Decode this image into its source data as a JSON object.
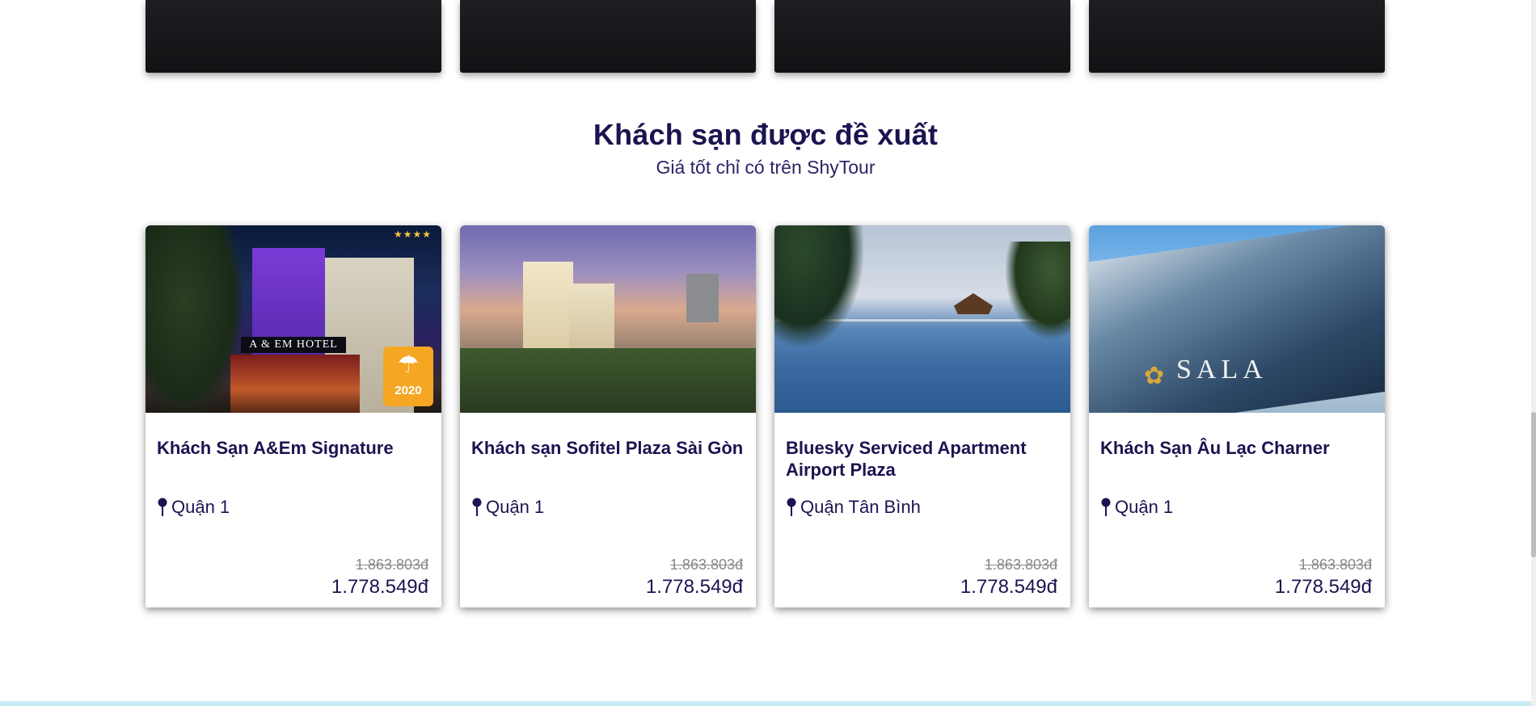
{
  "section": {
    "title": "Khách sạn được đề xuất",
    "subtitle": "Giá tốt chỉ có trên ShyTour"
  },
  "hotels": [
    {
      "name": "Khách Sạn A&Em Signature",
      "location": "Quận 1",
      "old_price": "1.863.803đ",
      "price": "1.778.549đ",
      "image_sign": "A & EM HOTEL",
      "badge_year": "2020"
    },
    {
      "name": "Khách sạn Sofitel Plaza Sài Gòn",
      "location": "Quận 1",
      "old_price": "1.863.803đ",
      "price": "1.778.549đ"
    },
    {
      "name": "Bluesky Serviced Apartment Airport Plaza",
      "location": "Quận Tân Bình",
      "old_price": "1.863.803đ",
      "price": "1.778.549đ"
    },
    {
      "name": "Khách Sạn Âu Lạc Charner",
      "location": "Quận 1",
      "old_price": "1.863.803đ",
      "price": "1.778.549đ",
      "image_sign": "SALA"
    }
  ],
  "icons": {
    "location": "map-pin-icon",
    "award": "award-badge-icon"
  },
  "colors": {
    "heading": "#1a1450",
    "old_price": "#888888",
    "badge": "#f5a623"
  }
}
